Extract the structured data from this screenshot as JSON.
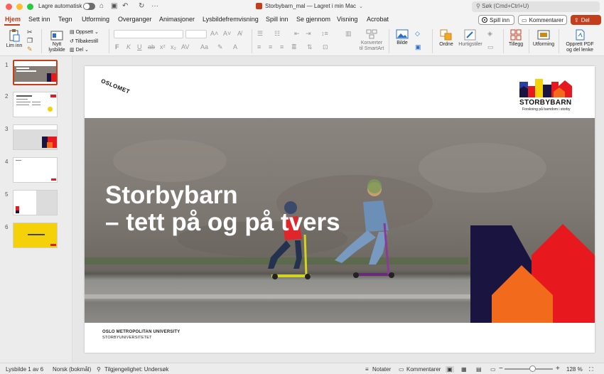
{
  "titlebar": {
    "autosave_label": "Lagre automatisk",
    "doc_title": "Storbybarn_mal — Lagret i min Mac",
    "search_placeholder": "Søk (Cmd+Ctrl+U)"
  },
  "menu": {
    "tabs": [
      "Hjem",
      "Sett inn",
      "Tegn",
      "Utforming",
      "Overganger",
      "Animasjoner",
      "Lysbildefremvisning",
      "Spill inn",
      "Se gjennom",
      "Visning",
      "Acrobat"
    ],
    "spill_inn_button": "Spill inn",
    "kommentarer_button": "Kommentarer",
    "del_button": "Del"
  },
  "ribbon": {
    "lim_inn": "Lim inn",
    "nytt_lysbilde": [
      "Nytt",
      "lysbilde"
    ],
    "oppsett": "Oppsett",
    "tilbakestill": "Tilbakestill",
    "del": "Del",
    "konverter": [
      "Konverter",
      "til SmartArt"
    ],
    "bilde": "Bilde",
    "ordne": "Ordne",
    "hurtigstiler": "Hurtigstiler",
    "tillegg": "Tillegg",
    "utforming": "Utforming",
    "opprett_pdf": [
      "Opprett PDF",
      "og del lenke"
    ]
  },
  "thumbnails": [
    "1",
    "2",
    "3",
    "4",
    "5",
    "6"
  ],
  "slide": {
    "title_line1": "Storbybarn",
    "title_line2": "– tett på og på tvers",
    "oslomet_logo": "OSLOMET",
    "storbybarn_name": "STORBYBARN",
    "storbybarn_tagline": "Forskning på barndom i storby",
    "university_line1": "OSLO METROPOLITAN UNIVERSITY",
    "university_line2": "STORBYUNIVERSITETET"
  },
  "status": {
    "slide_info": "Lysbilde 1 av 6",
    "language": "Norsk (bokmål)",
    "accessibility": "Tilgjengelighet: Undersøk",
    "notes": "Notater",
    "comments": "Kommentarer",
    "zoom": "128 %"
  },
  "colors": {
    "accent": "#c43e1c",
    "navy": "#1a1440",
    "red": "#e8191e",
    "orange": "#f26a1b"
  }
}
